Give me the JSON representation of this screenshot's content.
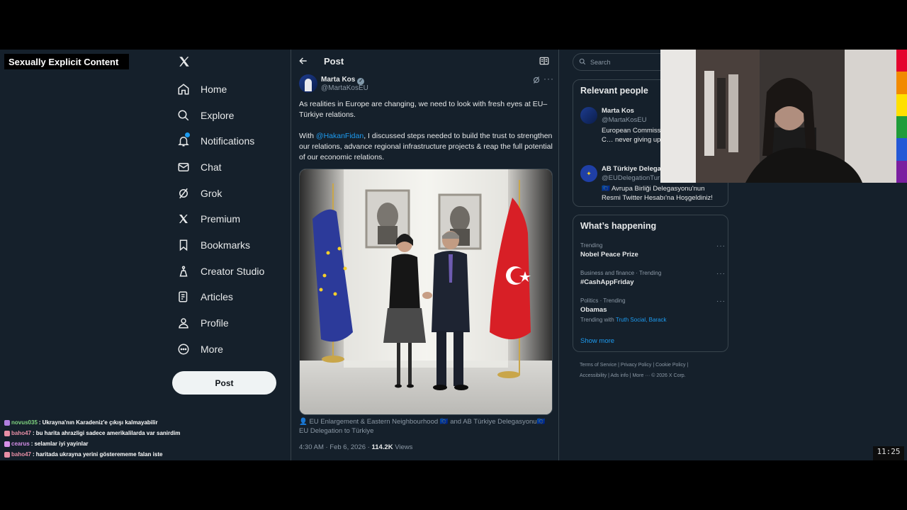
{
  "overlay": {
    "content_label": "Sexually Explicit Content"
  },
  "nav": {
    "items": [
      {
        "label": "Home",
        "icon": "home-icon"
      },
      {
        "label": "Explore",
        "icon": "search-icon"
      },
      {
        "label": "Notifications",
        "icon": "bell-icon"
      },
      {
        "label": "Chat",
        "icon": "mail-icon"
      },
      {
        "label": "Grok",
        "icon": "grok-icon"
      },
      {
        "label": "Premium",
        "icon": "x-logo-icon"
      },
      {
        "label": "Bookmarks",
        "icon": "bookmark-icon"
      },
      {
        "label": "Creator Studio",
        "icon": "creator-studio-icon"
      },
      {
        "label": "Articles",
        "icon": "articles-icon"
      },
      {
        "label": "Profile",
        "icon": "person-icon"
      },
      {
        "label": "More",
        "icon": "more-circle-icon"
      }
    ],
    "post_button": "Post"
  },
  "main": {
    "header_title": "Post",
    "author": {
      "name": "Marta Kos",
      "handle": "@MartaKosEU"
    },
    "text_p1": "As realities in Europe are changing, we need to look with fresh eyes at EU–Türkiye relations.",
    "text_p2_prefix": "With ",
    "text_p2_mention": "@HakanFidan",
    "text_p2_suffix": ", I discussed steps needed to build the trust to strengthen our relations, advance regional infrastructure projects & reap the full potential of our economic relations.",
    "tagged": "EU Enlargement & Eastern Neighbourhood 🇪🇺 and AB Türkiye Delegasyonu🇪🇺 EU Delegation to Türkiye",
    "timestamp": "4:30 AM · Feb 6, 2026 · ",
    "views_count": "114.2K",
    "views_label": " Views"
  },
  "right": {
    "search_placeholder": "Search",
    "relevant_title": "Relevant people",
    "people": [
      {
        "name": "Marta Kos",
        "handle": "@MartaKosEU",
        "bio": "European Commiss… Enlargement. 🇪🇺 C… never giving up."
      },
      {
        "name": "AB Türkiye Delega…",
        "handle": "@EUDelegationTur…",
        "bio": "🇪🇺 Avrupa Birliği Delegasyonu'nun Resmi Twitter Hesabı'na Hoşgeldiniz!"
      }
    ],
    "happening_title": "What’s happening",
    "trends": [
      {
        "category": "Trending",
        "name": "Nobel Peace Prize"
      },
      {
        "category": "Business and finance · Trending",
        "name": "#CashAppFriday"
      },
      {
        "category": "Politics · Trending",
        "name": "Obamas",
        "with_prefix": "Trending with ",
        "with_links": "Truth Social, Barack"
      }
    ],
    "show_more": "Show more",
    "footer_row1": "Terms of Service  |  Privacy Policy  |  Cookie Policy  |",
    "footer_row2": "Accessibility  |  Ads info  |  More ···  © 2026 X Corp."
  },
  "chat": [
    {
      "user": "novus035",
      "message": "Ukrayna'nın Karadeniz'e çıkışı kalmayabilir",
      "color": "#7fd37f"
    },
    {
      "user": "baho47",
      "message": "bu harita ahrazligi sadece amerikalilarda var sanirdim",
      "color": "#e88fa6"
    },
    {
      "user": "cearus",
      "message": "selamlar iyi yayinlar",
      "color": "#d68fe8"
    },
    {
      "user": "baho47",
      "message": "haritada ukrayna yerini gösterememe falan iste",
      "color": "#e88fa6"
    }
  ],
  "clock": "11:25",
  "colors": {
    "accent": "#1d9bf0",
    "background": "#15202b",
    "border": "#38444d"
  }
}
